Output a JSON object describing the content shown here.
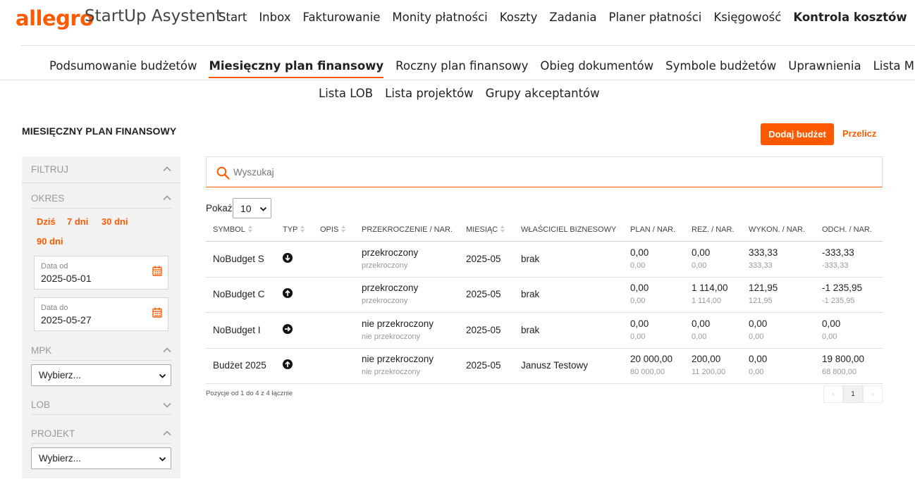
{
  "brand": {
    "logo": "allegro",
    "app": "StartUp Asystent",
    "accent": "#ff5a00"
  },
  "mainnav": [
    {
      "label": "Start"
    },
    {
      "label": "Inbox"
    },
    {
      "label": "Fakturowanie"
    },
    {
      "label": "Monity płatności"
    },
    {
      "label": "Koszty"
    },
    {
      "label": "Zadania"
    },
    {
      "label": "Planer płatności"
    },
    {
      "label": "Księgowość"
    },
    {
      "label": "Kontrola kosztów",
      "active": true
    }
  ],
  "subnav": [
    {
      "label": "Podsumowanie budżetów"
    },
    {
      "label": "Miesięczny plan finansowy",
      "active": true
    },
    {
      "label": "Roczny plan finansowy"
    },
    {
      "label": "Obieg dokumentów"
    },
    {
      "label": "Symbole budżetów"
    },
    {
      "label": "Uprawnienia"
    },
    {
      "label": "Lista MPK"
    }
  ],
  "subnav2": [
    {
      "label": "Lista LOB"
    },
    {
      "label": "Lista projektów"
    },
    {
      "label": "Grupy akceptantów"
    }
  ],
  "page": {
    "title": "MIESIĘCZNY PLAN FINANSOWY",
    "add_button": "Dodaj budżet",
    "recalc_link": "Przelicz"
  },
  "filters": {
    "header": "FILTRUJ",
    "okres": {
      "label": "OKRES",
      "quick": [
        "Dziś",
        "7 dni",
        "30 dni",
        "90 dni"
      ],
      "date_from_label": "Data od",
      "date_from": "2025-05-01",
      "date_to_label": "Data do",
      "date_to": "2025-05-27"
    },
    "mpk": {
      "label": "MPK",
      "selected": "Wybierz..."
    },
    "lob": {
      "label": "LOB"
    },
    "projekt": {
      "label": "PROJEKT",
      "selected": "Wybierz..."
    }
  },
  "search": {
    "placeholder": "Wyszukaj"
  },
  "page_size": {
    "label": "Pokaż",
    "value": "10"
  },
  "table": {
    "columns": [
      "SYMBOL",
      "TYP",
      "OPIS",
      "PRZEKROCZENIE / NAR.",
      "MIESIĄC",
      "WŁAŚCICIEL BIZNESOWY",
      "PLAN / NAR.",
      "REZ. / NAR.",
      "WYKON. / NAR.",
      "ODCH. / NAR."
    ],
    "rows": [
      {
        "symbol": "NoBudget S",
        "type_icon": "arrow-down-circle-icon",
        "opis": "",
        "przekroczenie": "przekroczony",
        "przekroczenie_nar": "przekroczony",
        "miesiac": "2025-05",
        "wlasciciel": "brak",
        "plan": "0,00",
        "plan_nar": "0,00",
        "rez": "0,00",
        "rez_nar": "0,00",
        "wykon": "333,33",
        "wykon_nar": "333,33",
        "odch": "-333,33",
        "odch_nar": "-333,33"
      },
      {
        "symbol": "NoBudget C",
        "type_icon": "arrow-up-circle-icon",
        "opis": "",
        "przekroczenie": "przekroczony",
        "przekroczenie_nar": "przekroczony",
        "miesiac": "2025-05",
        "wlasciciel": "brak",
        "plan": "0,00",
        "plan_nar": "0,00",
        "rez": "1 114,00",
        "rez_nar": "1 114,00",
        "wykon": "121,95",
        "wykon_nar": "121,95",
        "odch": "-1 235,95",
        "odch_nar": "-1 235,95"
      },
      {
        "symbol": "NoBudget I",
        "type_icon": "arrow-right-circle-icon",
        "opis": "",
        "przekroczenie": "nie przekroczony",
        "przekroczenie_nar": "nie przekroczony",
        "miesiac": "2025-05",
        "wlasciciel": "brak",
        "plan": "0,00",
        "plan_nar": "0,00",
        "rez": "0,00",
        "rez_nar": "0,00",
        "wykon": "0,00",
        "wykon_nar": "0,00",
        "odch": "0,00",
        "odch_nar": "0,00"
      },
      {
        "symbol": "Budżet 2025",
        "type_icon": "arrow-up-circle-icon",
        "opis": "",
        "przekroczenie": "nie przekroczony",
        "przekroczenie_nar": "nie przekroczony",
        "miesiac": "2025-05",
        "wlasciciel": "Janusz Testowy",
        "plan": "20 000,00",
        "plan_nar": "80 000,00",
        "rez": "200,00",
        "rez_nar": "11 200,00",
        "wykon": "0,00",
        "wykon_nar": "0,00",
        "odch": "19 800,00",
        "odch_nar": "68 800,00"
      }
    ]
  },
  "pagination": {
    "info": "Pozycje od 1 do 4 z 4 łącznie",
    "prev": "‹",
    "current": "1",
    "next": "›"
  }
}
